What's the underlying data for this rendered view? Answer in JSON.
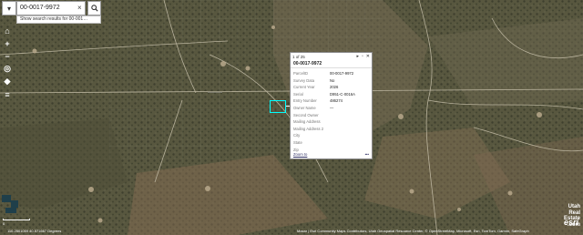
{
  "search": {
    "value": "00-0017-9972",
    "clear": "×",
    "suggestion": "Show search results for 00-001…"
  },
  "tools": [
    "home",
    "zoom-in",
    "zoom-out",
    "locate",
    "compass",
    "layers"
  ],
  "popup": {
    "counter": "1 of 25",
    "title": "00-0017-9972",
    "fields": [
      {
        "label": "ParcelID",
        "value": "00-0017-9972"
      },
      {
        "label": "Survey Data",
        "value": "No"
      },
      {
        "label": "Current Year",
        "value": "2026"
      },
      {
        "label": "Serial",
        "value": "D951-C-0016A"
      },
      {
        "label": "Entry Number",
        "value": "486274"
      },
      {
        "label": "Owner Name",
        "value": "—"
      },
      {
        "label": "Second Owner",
        "value": ""
      },
      {
        "label": "Mailing Address",
        "value": ""
      },
      {
        "label": "Mailing Address 2",
        "value": ""
      },
      {
        "label": "City",
        "value": ""
      },
      {
        "label": "State",
        "value": ""
      },
      {
        "label": "Zip",
        "value": ""
      }
    ],
    "zoom_to": "Zoom to",
    "more": "•••"
  },
  "scale": {
    "label": "0"
  },
  "coordinates": "110.2501059 40.571667 Degrees",
  "attribution": "Maxar | Esri Community Maps Contributors, Utah Geospatial Resource Center, © OpenStreetMap, Microsoft, Esri, TomTom, Garmin, SafeGraph",
  "logo": {
    "line1": "Utah",
    "line2": "Real",
    "line3": "Estate",
    "line4": ".com",
    "esri": "esri"
  },
  "colors": {
    "selection": "#00ffff",
    "imagery": "#5b5a47"
  }
}
